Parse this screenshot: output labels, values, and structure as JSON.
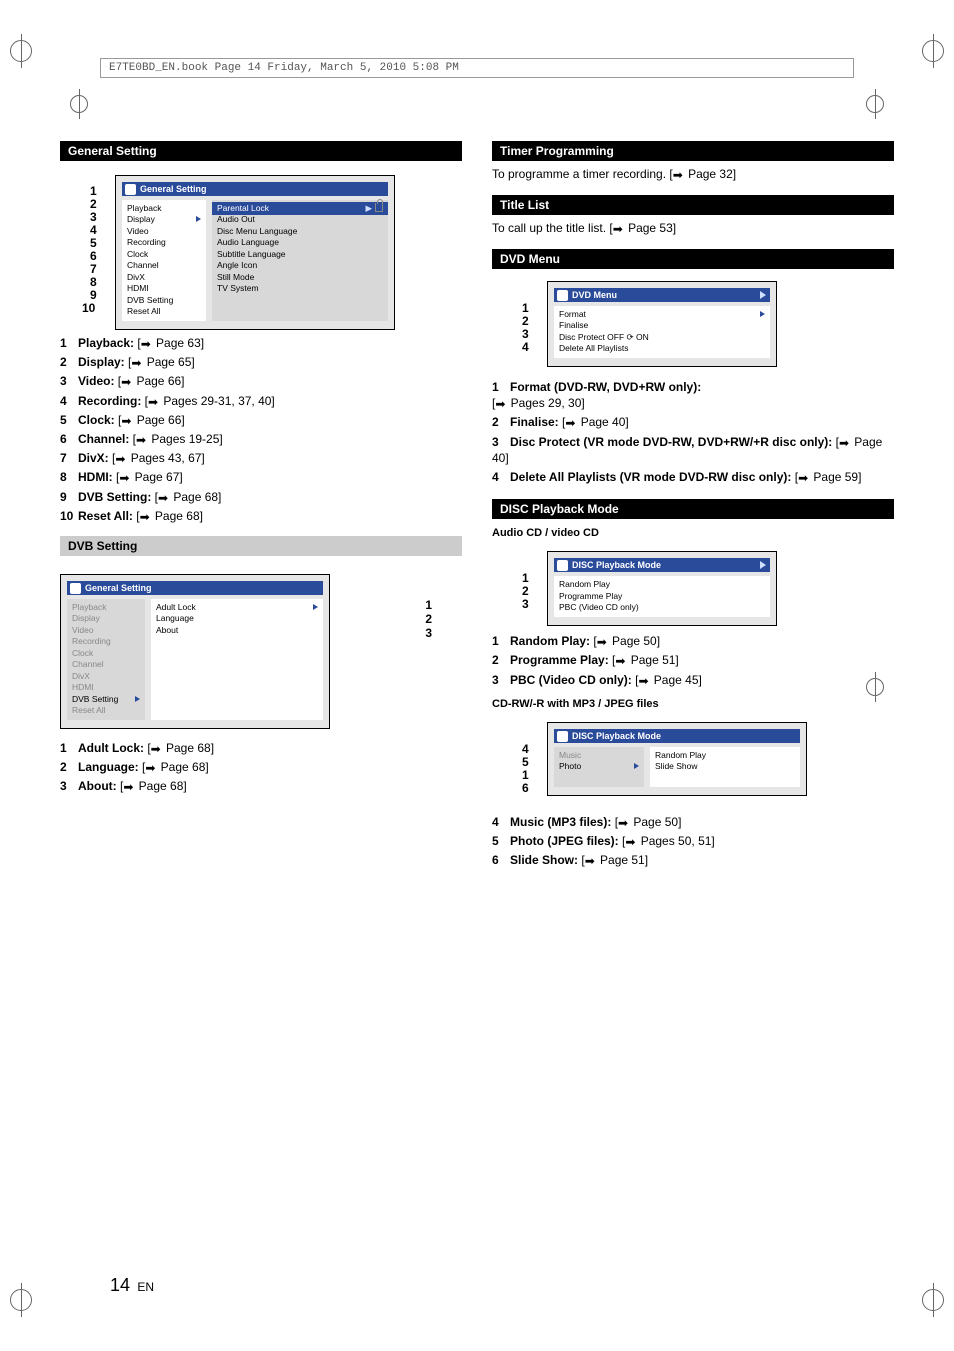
{
  "runhead": "E7TE0BD_EN.book  Page 14  Friday, March 5, 2010  5:08 PM",
  "page_number": "14",
  "page_lang": "EN",
  "arrow_glyph": "➡",
  "left_col": {
    "general_setting": {
      "band": "General Setting",
      "osd_title": "General Setting",
      "left_items": [
        "Playback",
        "Display",
        "Video",
        "Recording",
        "Clock",
        "Channel",
        "DivX",
        "HDMI",
        "DVB Setting",
        "Reset All"
      ],
      "right_items": [
        "Parental Lock",
        "Audio Out",
        "Disc Menu Language",
        "Audio Language",
        "Subtitle Language",
        "Angle Icon",
        "Still Mode",
        "TV System"
      ],
      "list": [
        {
          "n": "1",
          "label": "Playback:",
          "page": " Page 63]"
        },
        {
          "n": "2",
          "label": "Display:",
          "page": " Page 65]"
        },
        {
          "n": "3",
          "label": "Video:",
          "page": " Page 66]"
        },
        {
          "n": "4",
          "label": "Recording:",
          "page": " Pages 29-31, 37, 40]"
        },
        {
          "n": "5",
          "label": "Clock:",
          "page": " Page 66]"
        },
        {
          "n": "6",
          "label": "Channel:",
          "page": " Pages 19-25]"
        },
        {
          "n": "7",
          "label": "DivX:",
          "page": " Pages 43, 67]"
        },
        {
          "n": "8",
          "label": "HDMI:",
          "page": " Page 67]"
        },
        {
          "n": "9",
          "label": "DVB Setting:",
          "page": " Page 68]"
        },
        {
          "n": "10",
          "label": "Reset All:",
          "page": " Page 68]"
        }
      ]
    },
    "dvb_setting": {
      "band": "DVB Setting",
      "osd_title": "General Setting",
      "left_items": [
        "Playback",
        "Display",
        "Video",
        "Recording",
        "Clock",
        "Channel",
        "DivX",
        "HDMI",
        "DVB Setting",
        "Reset All"
      ],
      "right_items": [
        "Adult Lock",
        "Language",
        "About"
      ],
      "list": [
        {
          "n": "1",
          "label": "Adult Lock:",
          "page": " Page 68]"
        },
        {
          "n": "2",
          "label": "Language:",
          "page": " Page 68]"
        },
        {
          "n": "3",
          "label": "About:",
          "page": " Page 68]"
        }
      ]
    }
  },
  "right_col": {
    "timer": {
      "band": "Timer Programming",
      "intro_pre": "To programme a timer recording. [",
      "intro_post": " Page 32]"
    },
    "title_list": {
      "band": "Title List",
      "intro_pre": "To call up the title list. [",
      "intro_post": " Page 53]"
    },
    "dvd_menu": {
      "band": "DVD Menu",
      "osd_title": "DVD Menu",
      "items": [
        "Format",
        "Finalise",
        "Disc Protect OFF ⟳ ON",
        "Delete All Playlists"
      ],
      "list": [
        {
          "n": "1",
          "label": "Format (DVD-RW, DVD+RW only):",
          "page": " Pages 29, 30]",
          "break": true
        },
        {
          "n": "2",
          "label": "Finalise:",
          "page": " Page 40]"
        },
        {
          "n": "3",
          "label": "Disc Protect (VR mode DVD-RW, DVD+RW/+R disc only):",
          "page": " Page 40]"
        },
        {
          "n": "4",
          "label": "Delete All Playlists (VR mode DVD-RW disc only):",
          "page": " Page 59]"
        }
      ]
    },
    "disc_playback": {
      "band": "DISC Playback Mode",
      "sub1": "Audio CD / video CD",
      "osd1_title": "DISC Playback Mode",
      "osd1_items": [
        "Random Play",
        "Programme Play",
        "PBC (Video CD only)"
      ],
      "list1": [
        {
          "n": "1",
          "label": "Random Play:",
          "page": " Page 50]"
        },
        {
          "n": "2",
          "label": "Programme Play:",
          "page": " Page 51]"
        },
        {
          "n": "3",
          "label": "PBC (Video CD only):",
          "page": " Page 45]"
        }
      ],
      "sub2": "CD-RW/-R with MP3 / JPEG files",
      "osd2_title": "DISC Playback Mode",
      "osd2_left": [
        "Music",
        "Photo"
      ],
      "osd2_right": [
        "Random Play",
        "Slide Show"
      ],
      "list2": [
        {
          "n": "4",
          "label": "Music (MP3 files):",
          "page": " Page 50]"
        },
        {
          "n": "5",
          "label": "Photo (JPEG files):",
          "page": " Pages 50, 51]"
        },
        {
          "n": "6",
          "label": "Slide Show:",
          "page": " Page 51]"
        }
      ]
    }
  }
}
